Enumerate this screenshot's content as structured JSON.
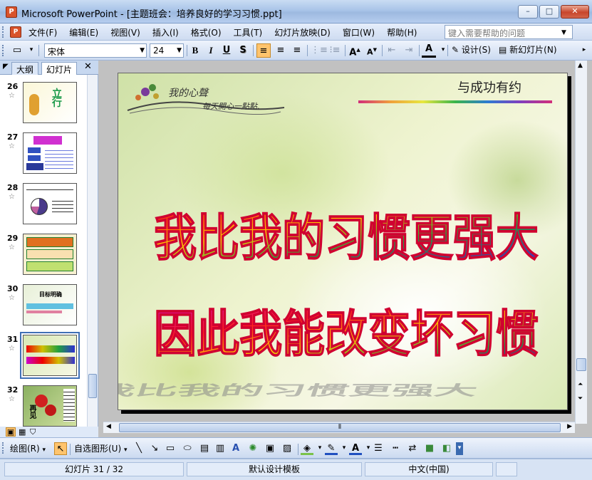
{
  "window": {
    "title": "Microsoft PowerPoint - [主题班会：培养良好的学习习惯.ppt]",
    "minimize": "–",
    "maximize": "□",
    "close": "✕"
  },
  "menu": {
    "items": [
      "文件(F)",
      "编辑(E)",
      "视图(V)",
      "插入(I)",
      "格式(O)",
      "工具(T)",
      "幻灯片放映(D)",
      "窗口(W)",
      "帮助(H)"
    ],
    "help_placeholder": "键入需要帮助的问题"
  },
  "toolbar": {
    "font_name": "宋体",
    "font_size": "24",
    "bold": "B",
    "italic": "I",
    "underline": "U",
    "shadow": "S",
    "design_label": "设计(S)",
    "new_slide_label": "新幻灯片(N)"
  },
  "panel": {
    "tab_outline": "大纲",
    "tab_slides": "幻灯片",
    "close": "✕",
    "thumbnails": [
      {
        "number": "26"
      },
      {
        "number": "27"
      },
      {
        "number": "28"
      },
      {
        "number": "29"
      },
      {
        "number": "30",
        "text": "目标明确"
      },
      {
        "number": "31",
        "selected": true
      },
      {
        "number": "32",
        "text": "再见"
      }
    ]
  },
  "slide": {
    "logo_text": "我的心聲",
    "logo_subtext": "每天開心一點點.",
    "tagline": "与成功有约",
    "line1": "我比我的习惯更强大",
    "line2": "因此我能改变坏习惯"
  },
  "drawing": {
    "draw_label": "绘图(R)",
    "autoshapes_label": "自选图形(U)"
  },
  "status": {
    "slide_counter": "幻灯片 31 / 32",
    "template": "默认设计模板",
    "language": "中文(中国)"
  },
  "colors": {
    "accent_selected": "#ffc46d",
    "text_gradient_top": "#ff0000",
    "text_gradient_mid": "#ffd700",
    "text_gradient_bottom": "#2020d0"
  }
}
